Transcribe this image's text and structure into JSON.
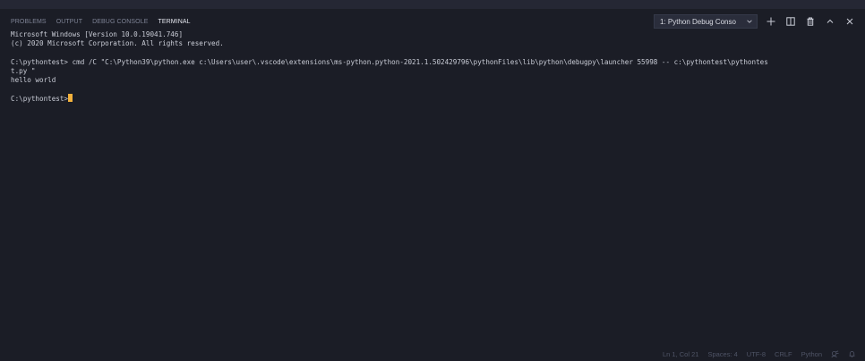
{
  "panel": {
    "tabs": [
      {
        "label": "PROBLEMS"
      },
      {
        "label": "OUTPUT"
      },
      {
        "label": "DEBUG CONSOLE"
      },
      {
        "label": "TERMINAL"
      }
    ],
    "terminal_selector": "1: Python Debug Conso",
    "icons": [
      "plus-icon",
      "split-icon",
      "trash-icon",
      "chevron-up-icon",
      "close-icon"
    ]
  },
  "terminal": {
    "lines": [
      "Microsoft Windows [Version 10.0.19041.746]",
      "(c) 2020 Microsoft Corporation. All rights reserved.",
      "",
      "C:\\pythontest> cmd /C \"C:\\Python39\\python.exe c:\\Users\\user\\.vscode\\extensions\\ms-python.python-2021.1.502429796\\pythonFiles\\lib\\python\\debugpy\\launcher 55998 -- c:\\pythontest\\pythontes",
      "t.py \"",
      "hello world",
      "",
      "C:\\pythontest>"
    ]
  },
  "statusbar": {
    "position": "Ln 1, Col 21",
    "spaces": "Spaces: 4",
    "encoding": "UTF-8",
    "eol": "CRLF",
    "language": "Python"
  },
  "colors": {
    "background": "#1b1d26",
    "cursor": "#f2b13c",
    "active_tab": "#e4e6ee"
  }
}
